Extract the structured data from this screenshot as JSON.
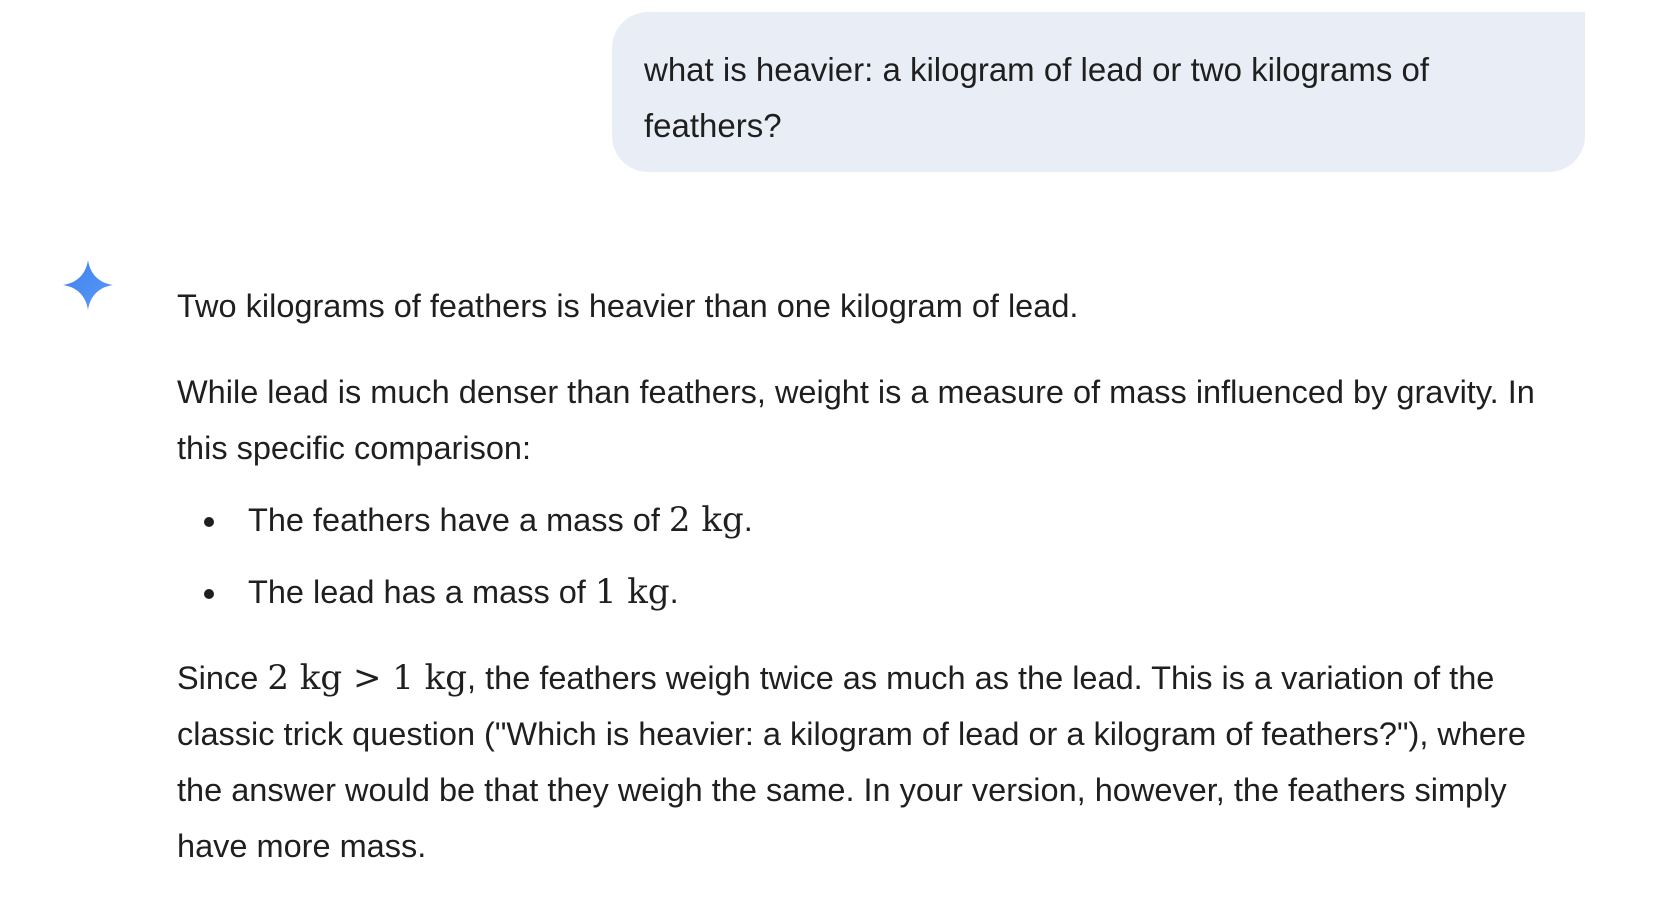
{
  "user_message": {
    "text": "what is heavier: a kilogram of lead or two kilograms of feathers?"
  },
  "assistant": {
    "icon": "gemini-sparkle-icon",
    "accent_color": "#4c8df6",
    "intro": "Two kilograms of feathers is heavier than one kilogram of lead.",
    "explanation": "While lead is much denser than feathers, weight is a measure of mass influenced by gravity. In this specific comparison:",
    "bullets": [
      {
        "text": "The feathers have a mass of ",
        "math": "2 kg",
        "suffix": "."
      },
      {
        "text": "The lead has a mass of ",
        "math": "1 kg",
        "suffix": "."
      }
    ],
    "conclusion": {
      "prefix": "Since ",
      "math": "2 kg > 1 kg",
      "text": ", the feathers weigh twice as much as the lead. This is a variation of the classic trick question (\"Which is heavier: a kilogram of lead or a kilogram of feathers?\"), where the answer would be that they weigh the same. In your version, however, the feathers simply have more mass."
    }
  }
}
